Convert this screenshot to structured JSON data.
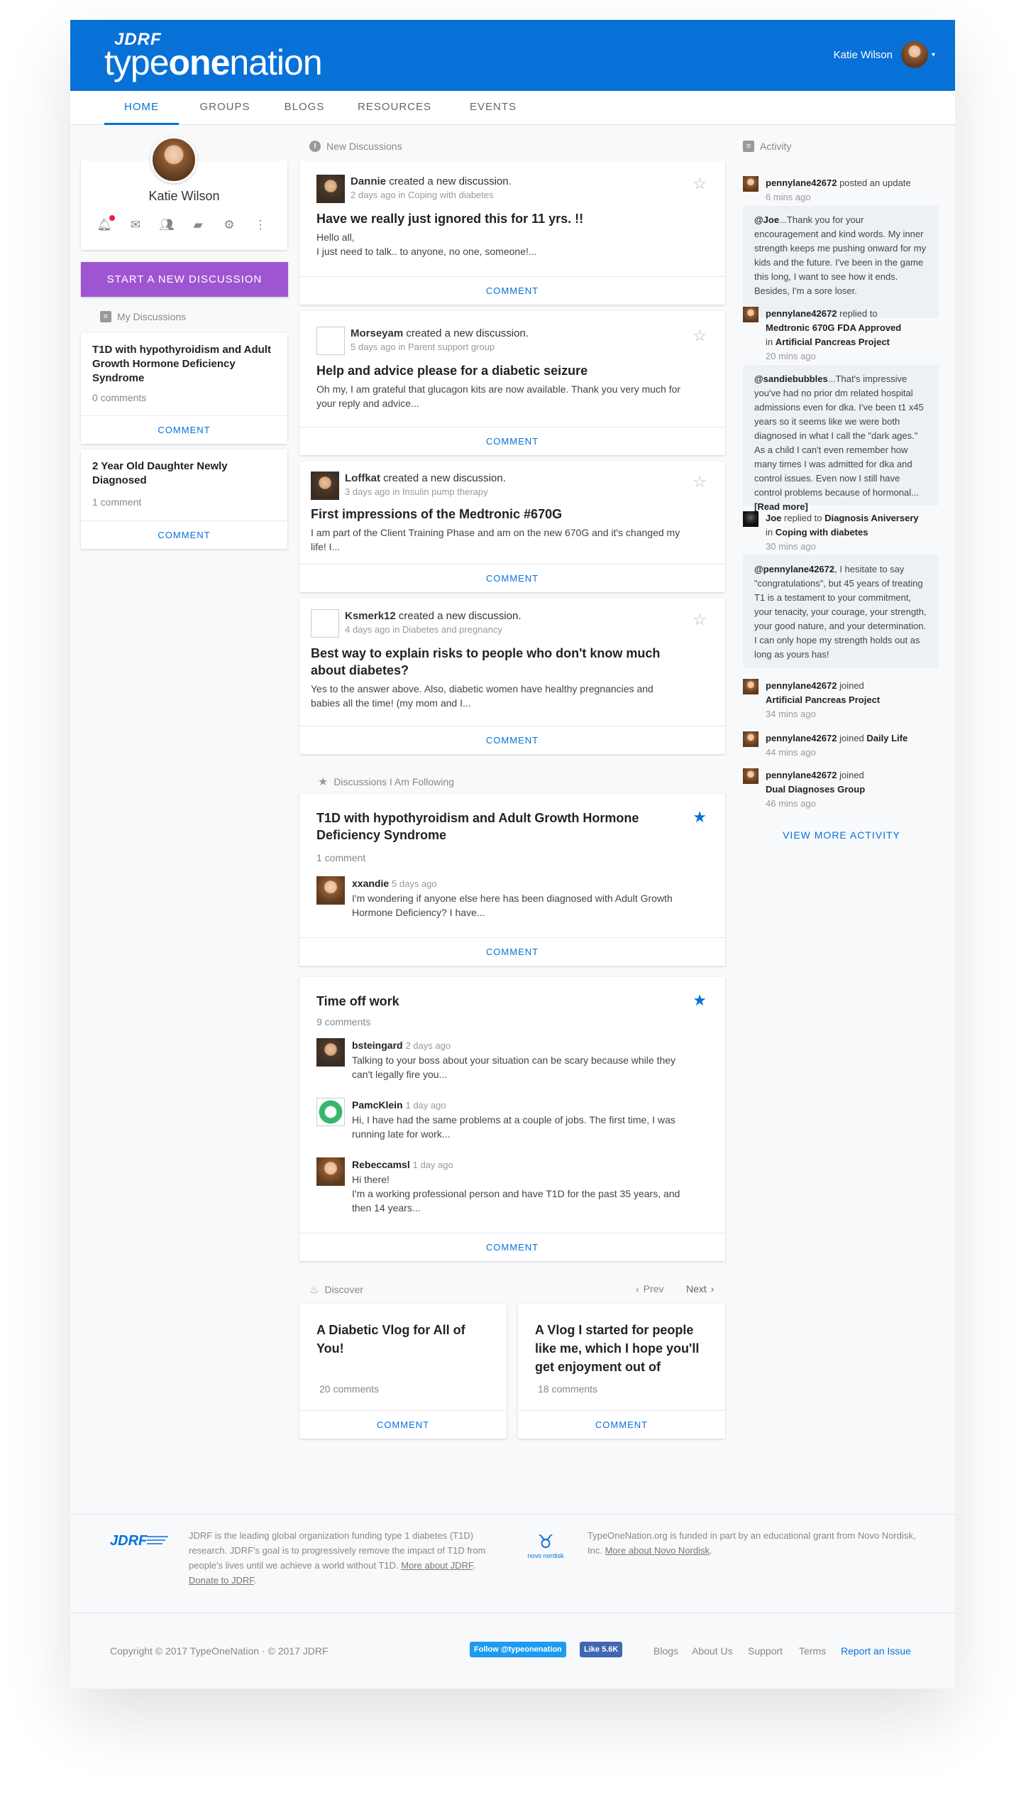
{
  "brand": {
    "jdrf": "JDRF",
    "name_light1": "type",
    "name_bold": "one",
    "name_light2": "nation"
  },
  "header": {
    "user_name": "Katie Wilson",
    "menu_icon": "chevron-down-icon"
  },
  "nav": {
    "tabs": [
      {
        "label": "HOME"
      },
      {
        "label": "GROUPS"
      },
      {
        "label": "BLOGS"
      },
      {
        "label": "RESOURCES"
      },
      {
        "label": "EVENTS"
      }
    ],
    "active": "HOME"
  },
  "profile": {
    "name": "Katie Wilson",
    "icons": [
      "bell-icon",
      "mail-icon",
      "people-icon",
      "chat-icon",
      "gear-icon",
      "more-icon"
    ]
  },
  "start_button": "START A NEW DISCUSSION",
  "my_discussions": {
    "title": "My Discussions",
    "items": [
      {
        "title": "T1D with hypothyroidism and Adult Growth Hormone Deficiency Syndrome",
        "meta": "0 comments",
        "action": "COMMENT"
      },
      {
        "title": "2 Year Old Daughter Newly Diagnosed",
        "meta": "1 comment",
        "action": "COMMENT"
      }
    ]
  },
  "new_discussions": {
    "title": "New Discussions",
    "items": [
      {
        "user": "Dannie",
        "verb": "created a new discussion.",
        "when": "2 days ago in Coping with diabetes",
        "title": "Have we really just ignored this for 11 yrs. !!",
        "body": "Hello all,\nI just need to talk.. to anyone, no one, someone!...",
        "action": "COMMENT"
      },
      {
        "user": "Morseyam",
        "verb": "created a new discussion.",
        "when": "5 days ago in Parent support group",
        "title": "Help and advice please for a diabetic seizure",
        "body": "Oh my, I am grateful that glucagon kits are now available. Thank you very much for your reply and advice...",
        "action": "COMMENT"
      },
      {
        "user": "Loffkat",
        "verb": "created a new discussion.",
        "when": "3 days ago in Insulin pump therapy",
        "title": "First impressions of the Medtronic #670G",
        "body": "I am part of the Client Training Phase and am on the new 670G and it's changed my life! I...",
        "action": "COMMENT"
      },
      {
        "user": "Ksmerk12",
        "verb": "created a new discussion.",
        "when": "4 days ago in Diabetes and pregnancy",
        "title": "Best way to explain risks to people who don't know much about diabetes?",
        "body": "Yes to the answer above. Also, diabetic women have healthy pregnancies and babies all the time! (my mom and I...",
        "action": "COMMENT"
      }
    ]
  },
  "following": {
    "title": "Discussions I Am Following",
    "items": [
      {
        "title": "T1D with hypothyroidism and Adult Growth Hormone Deficiency Syndrome",
        "count": "1 comment",
        "replies": [
          {
            "user": "xxandie",
            "when": "5 days ago",
            "text": "I'm wondering if anyone else here has been diagnosed with Adult Growth Hormone Deficiency? I have..."
          }
        ],
        "action": "COMMENT"
      },
      {
        "title": "Time off work",
        "count": "9 comments",
        "replies": [
          {
            "user": "bsteingard",
            "when": "2 days ago",
            "text": "Talking to your boss about your situation can be scary because while they can't legally fire you..."
          },
          {
            "user": "PamcKlein",
            "when": "1 day ago",
            "text": "Hi, I have had the same problems at a couple of jobs. The first time, I was running late for work..."
          },
          {
            "user": "Rebeccamsl",
            "when": "1 day ago",
            "text": "Hi there!\nI'm a working professional person and have T1D for the past 35 years, and then 14 years..."
          }
        ],
        "action": "COMMENT"
      }
    ]
  },
  "discover": {
    "title": "Discover",
    "prev": "Prev",
    "next": "Next",
    "items": [
      {
        "title": "A Diabetic Vlog for All of You!",
        "count": "20 comments",
        "action": "COMMENT"
      },
      {
        "title": "A Vlog I started for people like me, which I hope you'll get enjoyment out of",
        "count": "18 comments",
        "action": "COMMENT"
      }
    ]
  },
  "activity": {
    "title": "Activity",
    "a1": {
      "user": "pennylane42672",
      "text": "posted an update",
      "time": "6 mins ago",
      "quote_user": "@Joe",
      "quote": "...Thank you for your encouragement and kind words. My inner strength keeps me pushing onward for my kids and the future. I've been in the game this long, I want to see how it ends. Besides, I'm a sore loser."
    },
    "a2": {
      "user": "pennylane42672",
      "text": "replied to",
      "target": "Medtronic 670G FDA Approved",
      "in": "in",
      "group": "Artificial Pancreas Project",
      "time": "20 mins ago",
      "quote_user": "@sandiebubbles",
      "quote": "...That's impressive you've had no prior dm related hospital admissions even for dka. I've been t1 x45 years so it seems like we were both diagnosed in what I call the \"dark ages.\" As a child I can't even remember how many times I was admitted for dka and control issues. Even now I still have control problems because of hormonal...",
      "read_more": "[Read more]"
    },
    "a3": {
      "user": "Joe",
      "text": "replied to",
      "target": "Diagnosis Aniversery",
      "in": "in",
      "group": "Coping with diabetes",
      "time": "30 mins ago",
      "quote_user": "@pennylane42672",
      "quote": ", I hesitate to say \"congratulations\", but 45 years of treating T1 is a testament to your commitment, your tenacity, your courage, your strength, your good nature, and your determination. I can only hope my strength holds out as long as yours has!"
    },
    "a4": {
      "user": "pennylane42672",
      "text": "joined",
      "group": "Artificial Pancreas Project",
      "time": "34 mins ago"
    },
    "a5": {
      "user": "pennylane42672",
      "text": "joined",
      "group": "Daily Life",
      "time": "44 mins ago"
    },
    "a6": {
      "user": "pennylane42672",
      "text": "joined",
      "group": "Dual Diagnoses Group",
      "time": "46 mins ago"
    },
    "view_more": "VIEW MORE ACTIVITY"
  },
  "footer": {
    "jdrf_text": "JDRF is the leading global organization funding type 1 diabetes (T1D) research. JDRF's goal is to progressively remove the impact of T1D from people's lives until we achieve a world without T1D.",
    "jdrf_more": "More about JDRF",
    "jdrf_donate": "Donate to JDRF",
    "novo_logo": "novo nordisk",
    "novo_text": "TypeOneNation.org is funded in part by an educational grant from Novo Nordisk, Inc.",
    "novo_more": "More about Novo Nordisk",
    "copyright": "Copyright © 2017 TypeOneNation  ·  © 2017 JDRF",
    "twitter": "Follow @typeonenation",
    "fb_like": "Like 5.6K",
    "links": [
      "Blogs",
      "About Us",
      "Support",
      "Terms"
    ],
    "report": "Report an Issue"
  },
  "colors": {
    "brand_blue": "#0771d8",
    "start_purple": "#9f55d2"
  }
}
